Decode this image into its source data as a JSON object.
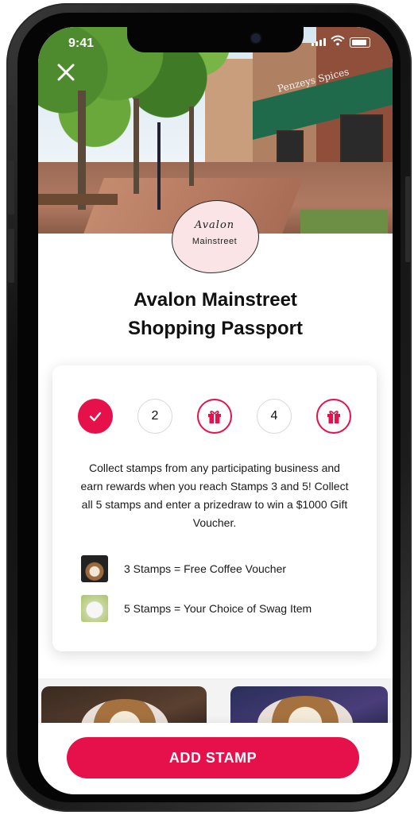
{
  "status_bar": {
    "time": "9:41"
  },
  "logo": {
    "line1": "Avalon",
    "line2": "Mainstreet"
  },
  "hero": {
    "sign_text": "Penzeys Spices"
  },
  "title": {
    "line1": "Avalon Mainstreet",
    "line2": "Shopping Passport"
  },
  "stamps": [
    {
      "type": "done",
      "label": "",
      "icon": "check-icon"
    },
    {
      "type": "number",
      "label": "2"
    },
    {
      "type": "gift",
      "label": "",
      "icon": "gift-icon"
    },
    {
      "type": "number",
      "label": "4"
    },
    {
      "type": "gift",
      "label": "",
      "icon": "gift-icon"
    }
  ],
  "description": "Collect stamps from any participating business and earn rewards when you reach Stamps 3 and 5! Collect all 5 stamps and enter a prizedraw to win a $1000 Gift Voucher.",
  "rewards": [
    {
      "text": "3 Stamps = Free Coffee Voucher",
      "icon": "coffee-thumbnail"
    },
    {
      "text": "5 Stamps = Your Choice of Swag Item",
      "icon": "swag-thumbnail"
    }
  ],
  "cta": {
    "label": "ADD STAMP"
  },
  "colors": {
    "accent": "#e6104a",
    "logo_bg": "#fae4e5"
  }
}
